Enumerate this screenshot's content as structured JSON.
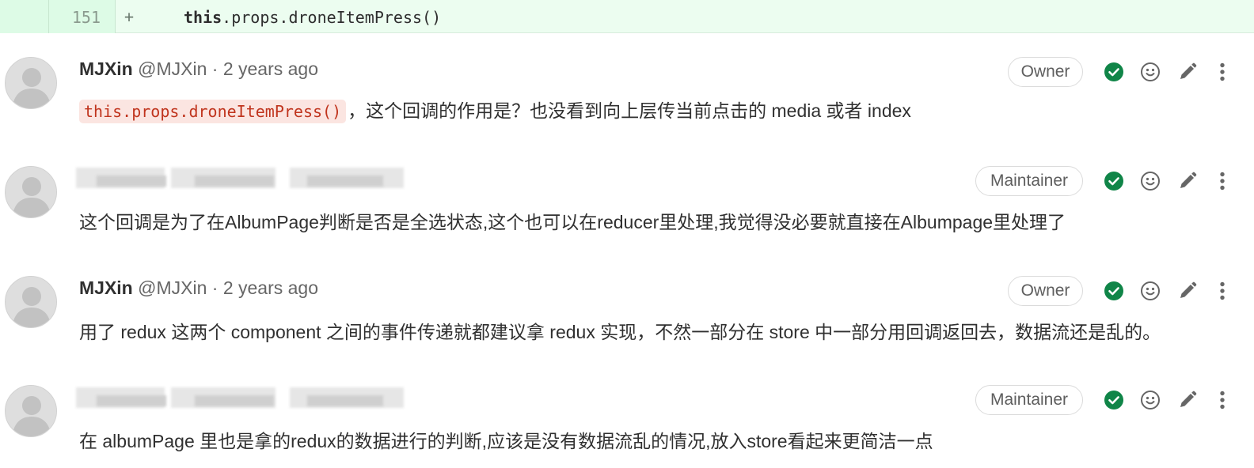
{
  "diff": {
    "line_number": "151",
    "marker": "+",
    "code_keyword": "this",
    "code_rest": ".props.droneItemPress()"
  },
  "notes": [
    {
      "author_name": "MJXin",
      "author_username": "@MJXin",
      "separator": "·",
      "time": "2 years ago",
      "role": "Owner",
      "inline_code": "this.props.droneItemPress()",
      "body": "，这个回调的作用是？也没看到向上层传当前点击的 media 或者 index"
    },
    {
      "author_name": "",
      "role": "Maintainer",
      "body": "这个回调是为了在AlbumPage判断是否是全选状态,这个也可以在reducer里处理,我觉得没必要就直接在Albumpage里处理了"
    },
    {
      "author_name": "MJXin",
      "author_username": "@MJXin",
      "separator": "·",
      "time": "2 years ago",
      "role": "Owner",
      "body": "用了 redux 这两个 component 之间的事件传递就都建议拿 redux 实现，不然一部分在 store 中一部分用回调返回去，数据流还是乱的。"
    },
    {
      "author_name": "",
      "role": "Maintainer",
      "body": "在 albumPage 里也是拿的redux的数据进行的判断,应该是没有数据流乱的情况,放入store看起来更简洁一点"
    }
  ],
  "icons": {
    "resolve": "check-circle-icon",
    "emoji": "smiley-icon",
    "edit": "pencil-icon",
    "more": "kebab-menu-icon"
  },
  "colors": {
    "diff_background": "#ecfdf0",
    "resolve_green": "#108548",
    "inline_code_text": "#c0341d",
    "inline_code_bg": "#fbe5e1"
  }
}
